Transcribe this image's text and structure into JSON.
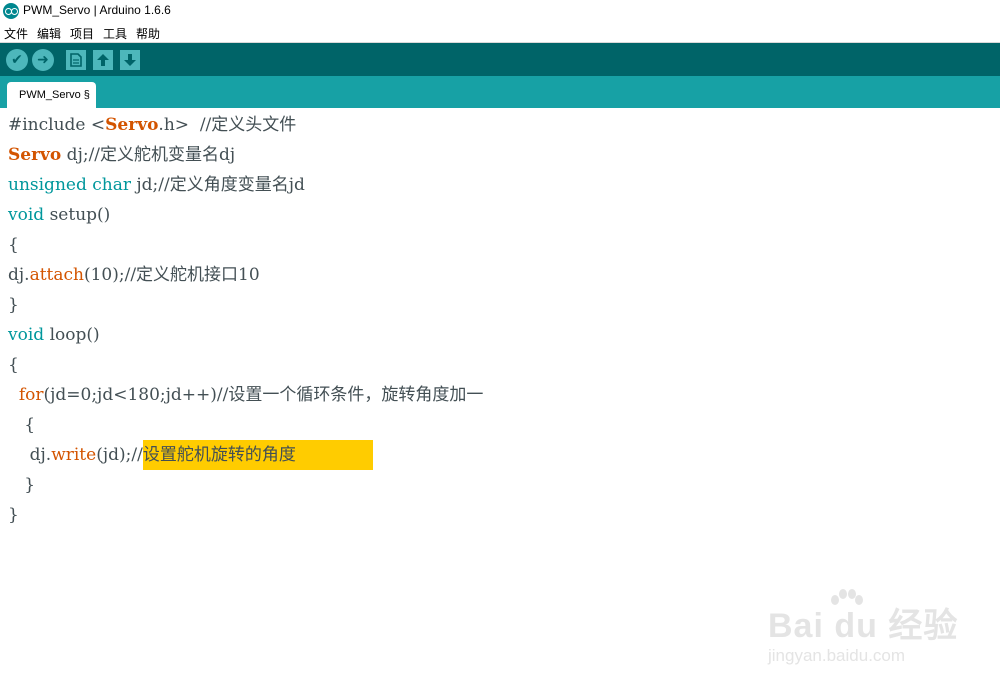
{
  "window": {
    "title": "PWM_Servo | Arduino 1.6.6"
  },
  "menu": {
    "items": [
      "文件",
      "编辑",
      "项目",
      "工具",
      "帮助"
    ]
  },
  "toolbar": {
    "verify_icon": "check-icon",
    "upload_icon": "arrow-right-icon",
    "new_icon": "document-icon",
    "open_icon": "arrow-up-icon",
    "save_icon": "arrow-down-icon"
  },
  "tabs": [
    {
      "label": "PWM_Servo §"
    }
  ],
  "code": {
    "l1": {
      "a": "#include <",
      "b": "Servo",
      "c": ".h>  ",
      "d": "//定义头文件"
    },
    "l2": {
      "a": "Servo",
      "b": " dj;",
      "c": "//定义舵机变量名dj"
    },
    "l3": {
      "a": "unsigned",
      "b": " ",
      "c": "char",
      "d": " jd;",
      "e": "//定义角度变量名jd"
    },
    "l4": {
      "a": "void",
      "b": " setup()"
    },
    "l5": {
      "a": "{"
    },
    "l6": {
      "a": "dj.",
      "b": "attach",
      "c": "(10);",
      "d": "//定义舵机接口10"
    },
    "l7": {
      "a": "}"
    },
    "l8": {
      "a": "void",
      "b": " loop()"
    },
    "l9": {
      "a": "{"
    },
    "l10": {
      "a": "  ",
      "b": "for",
      "c": "(jd=0;jd<180;jd++)",
      "d": "//设置一个循环条件，旋转角度加一"
    },
    "l11": {
      "a": "   {"
    },
    "l12": {
      "a": "    dj.",
      "b": "write",
      "c": "(jd);",
      "d": "//",
      "e": "设置舵机旋转的角度"
    },
    "l13": {
      "a": "   }"
    },
    "l14": {
      "a": "}"
    }
  },
  "colors": {
    "toolbar": "#006468",
    "tabbar": "#17a1a5",
    "keyword": "#d35400",
    "type": "#00979c",
    "highlight": "#ffcc00"
  },
  "watermark": {
    "brand": "Bai du 经验",
    "url": "jingyan.baidu.com"
  }
}
